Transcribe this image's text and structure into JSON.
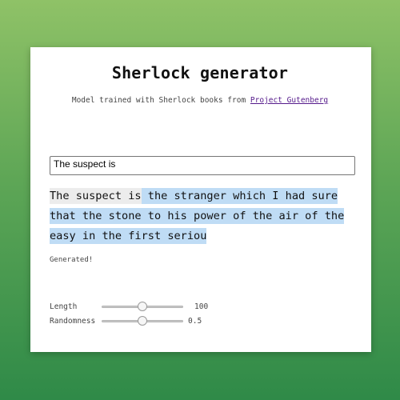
{
  "header": {
    "title": "Sherlock generator",
    "subtitle_prefix": "Model trained with Sherlock books from ",
    "subtitle_link": "Project Gutenberg"
  },
  "prompt": {
    "value": "The suspect is"
  },
  "output": {
    "seed_text": "The suspect is",
    "generated_text": " the stranger which I had sure that the stone to his power of the air of the easy in the first seriou"
  },
  "status": "Generated!",
  "controls": {
    "length": {
      "label": "Length",
      "value": "100",
      "fraction": 0.5
    },
    "randomness": {
      "label": "Randomness",
      "value": "0.5",
      "fraction": 0.5
    }
  }
}
